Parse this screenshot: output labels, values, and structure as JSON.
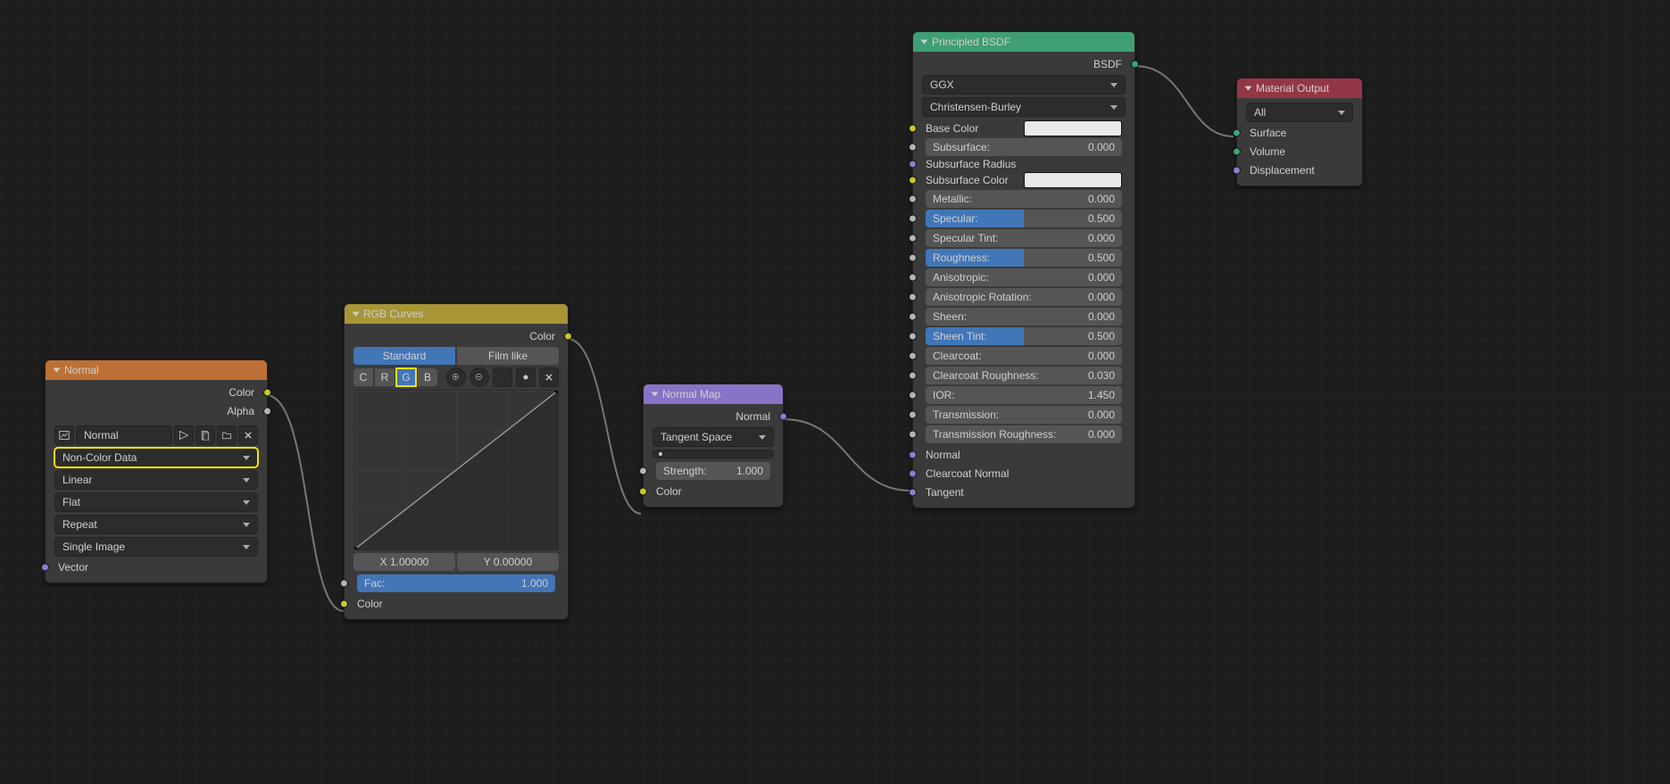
{
  "nodes": {
    "normal_tex": {
      "title": "Normal",
      "outputs": {
        "color": "Color",
        "alpha": "Alpha"
      },
      "image_name": "Normal",
      "colorspace": "Non-Color Data",
      "interpolation": "Linear",
      "projection": "Flat",
      "extension": "Repeat",
      "source": "Single Image",
      "inputs": {
        "vector": "Vector"
      }
    },
    "rgb_curves": {
      "title": "RGB Curves",
      "outputs": {
        "color": "Color"
      },
      "tone": {
        "standard": "Standard",
        "filmlike": "Film like"
      },
      "channels": {
        "c": "C",
        "r": "R",
        "g": "G",
        "b": "B"
      },
      "coord": {
        "x": "X 1.00000",
        "y": "Y 0.00000"
      },
      "fac": {
        "label": "Fac:",
        "value": "1.000"
      },
      "inputs": {
        "color": "Color"
      }
    },
    "normal_map": {
      "title": "Normal Map",
      "outputs": {
        "normal": "Normal"
      },
      "space": "Tangent Space",
      "strength": {
        "label": "Strength:",
        "value": "1.000"
      },
      "inputs": {
        "color": "Color"
      }
    },
    "bsdf": {
      "title": "Principled BSDF",
      "outputs": {
        "bsdf": "BSDF"
      },
      "distribution": "GGX",
      "sss_method": "Christensen-Burley",
      "props": [
        {
          "name": "Base Color",
          "type": "color"
        },
        {
          "name": "Subsurface:",
          "value": "0.000",
          "fill": 0
        },
        {
          "name": "Subsurface Radius",
          "type": "expand"
        },
        {
          "name": "Subsurface Color",
          "type": "color"
        },
        {
          "name": "Metallic:",
          "value": "0.000",
          "fill": 0
        },
        {
          "name": "Specular:",
          "value": "0.500",
          "fill": 50,
          "blue": true
        },
        {
          "name": "Specular Tint:",
          "value": "0.000",
          "fill": 0
        },
        {
          "name": "Roughness:",
          "value": "0.500",
          "fill": 50,
          "blue": true
        },
        {
          "name": "Anisotropic:",
          "value": "0.000",
          "fill": 0
        },
        {
          "name": "Anisotropic Rotation:",
          "value": "0.000",
          "fill": 0
        },
        {
          "name": "Sheen:",
          "value": "0.000",
          "fill": 0
        },
        {
          "name": "Sheen Tint:",
          "value": "0.500",
          "fill": 50,
          "blue": true
        },
        {
          "name": "Clearcoat:",
          "value": "0.000",
          "fill": 0
        },
        {
          "name": "Clearcoat Roughness:",
          "value": "0.030",
          "fill": 3
        },
        {
          "name": "IOR:",
          "value": "1.450",
          "plain": true
        },
        {
          "name": "Transmission:",
          "value": "0.000",
          "fill": 0
        },
        {
          "name": "Transmission Roughness:",
          "value": "0.000",
          "fill": 0
        }
      ],
      "extra_inputs": {
        "normal": "Normal",
        "clearcoat_normal": "Clearcoat Normal",
        "tangent": "Tangent"
      }
    },
    "mat_output": {
      "title": "Material Output",
      "target": "All",
      "inputs": {
        "surface": "Surface",
        "volume": "Volume",
        "displacement": "Displacement"
      }
    }
  }
}
